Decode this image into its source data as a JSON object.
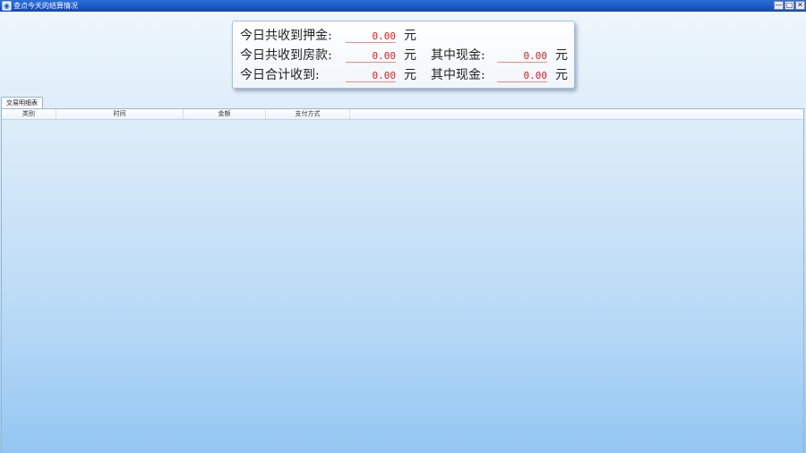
{
  "window": {
    "title": "查点今天的结算情况",
    "minimize": "—",
    "maximize": "□",
    "close": "✕"
  },
  "summary": {
    "deposit_label": "今日共收到押金:",
    "deposit_value": "0.00",
    "room_label": "今日共收到房款:",
    "room_value": "0.00",
    "room_cash_label": "其中现金:",
    "room_cash_value": "0.00",
    "total_label": "今日合计收到:",
    "total_value": "0.00",
    "total_cash_label": "其中现金:",
    "total_cash_value": "0.00",
    "unit": "元"
  },
  "tab": {
    "label": "交易明细表"
  },
  "table": {
    "columns": [
      "类别",
      "时间",
      "金额",
      "支付方式"
    ],
    "rows": []
  }
}
